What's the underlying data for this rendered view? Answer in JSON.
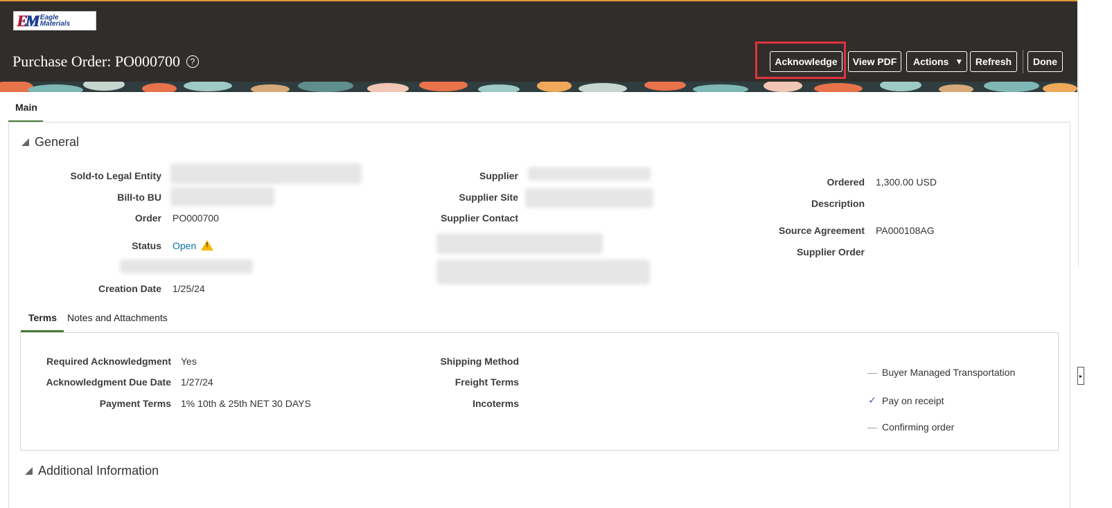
{
  "header": {
    "logo": {
      "initials": "EM",
      "line1": "Eagle",
      "line2": "Materials"
    },
    "title": "Purchase Order: PO000700",
    "help_icon": "?",
    "buttons": {
      "acknowledge": "Acknowledge",
      "view_pdf": "View PDF",
      "actions": "Actions",
      "refresh": "Refresh",
      "done": "Done"
    }
  },
  "tabs": {
    "main": "Main"
  },
  "general": {
    "section_title": "General",
    "labels": {
      "sold_to": "Sold-to Legal Entity",
      "bill_to": "Bill-to BU",
      "order": "Order",
      "status": "Status",
      "creation_date": "Creation Date",
      "supplier": "Supplier",
      "supplier_site": "Supplier Site",
      "supplier_contact": "Supplier Contact",
      "ordered": "Ordered",
      "description": "Description",
      "source_agreement": "Source Agreement",
      "supplier_order": "Supplier Order"
    },
    "values": {
      "order": "PO000700",
      "status": "Open",
      "creation_date": "1/25/24",
      "ordered_amount": "1,300.00",
      "ordered_currency": "USD",
      "source_agreement": "PA000108AG"
    }
  },
  "subtabs": {
    "terms": "Terms",
    "notes": "Notes and Attachments"
  },
  "terms": {
    "labels": {
      "required_ack": "Required Acknowledgment",
      "ack_due": "Acknowledgment Due Date",
      "payment_terms": "Payment Terms",
      "shipping_method": "Shipping Method",
      "freight_terms": "Freight Terms",
      "incoterms": "Incoterms"
    },
    "values": {
      "required_ack": "Yes",
      "ack_due": "1/27/24",
      "payment_terms": "1% 10th & 25th NET 30 DAYS"
    },
    "flags": [
      {
        "label": "Buyer Managed Transportation",
        "checked": false
      },
      {
        "label": "Pay on receipt",
        "checked": true
      },
      {
        "label": "Confirming order",
        "checked": false
      }
    ]
  },
  "additional": {
    "section_title": "Additional Information"
  },
  "icons": {
    "help": "help-icon",
    "warning": "warning-icon",
    "dropdown": "caret-down-icon",
    "collapse": "collapse-triangle-icon",
    "check": "check-icon",
    "dash": "dash-icon"
  },
  "colors": {
    "header_bg": "#312d2a",
    "accent": "#4b7b3a",
    "link": "#0e6fa8",
    "highlight": "#e0343d",
    "warning": "#f5b800"
  }
}
